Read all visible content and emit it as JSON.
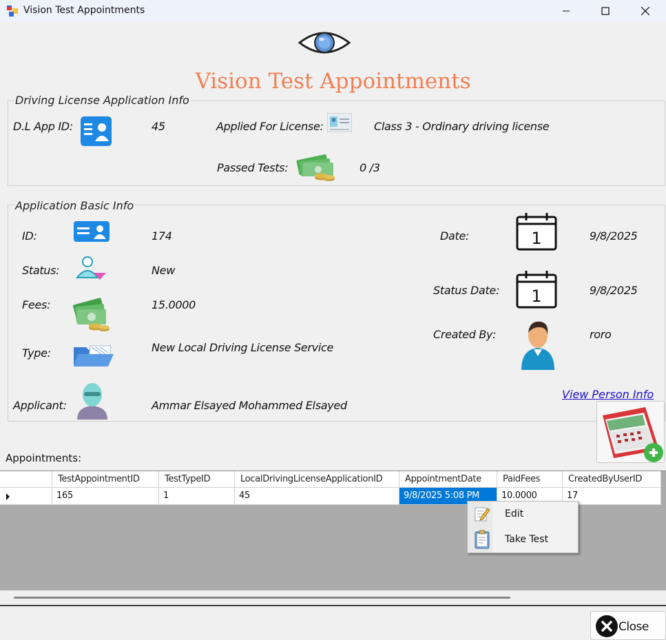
{
  "window": {
    "title": "Vision Test Appointments",
    "controls": {
      "minimize": "minimize-icon",
      "maximize": "maximize-icon",
      "close": "close-icon"
    }
  },
  "header": {
    "title": "Vision Test Appointments",
    "icon": "eye-icon",
    "title_color": "#f27f53"
  },
  "license_info": {
    "legend": "Driving License Application Info",
    "app_id_label": "D.L App ID:",
    "app_id_value": "45",
    "applied_for_label": "Applied For License:",
    "applied_for_value": "Class 3 - Ordinary driving license",
    "passed_tests_label": "Passed Tests:",
    "passed_tests_value": "0  /3"
  },
  "basic_info": {
    "legend": "Application Basic Info",
    "id_label": "ID:",
    "id_value": "174",
    "status_label": "Status:",
    "status_value": "New",
    "fees_label": "Fees:",
    "fees_value": "15.0000",
    "type_label": "Type:",
    "type_value": "New Local Driving License Service",
    "applicant_label": "Applicant:",
    "applicant_value": "Ammar Elsayed Mohammed Elsayed",
    "date_label": "Date:",
    "date_value": "9/8/2025",
    "status_date_label": "Status Date:",
    "status_date_value": "9/8/2025",
    "created_by_label": "Created By:",
    "created_by_value": "roro",
    "view_person_link": "View Person Info"
  },
  "appointments": {
    "label": "Appointments:",
    "columns": [
      "TestAppointmentID",
      "TestTypeID",
      "LocalDrivingLicenseApplicationID",
      "AppointmentDate",
      "PaidFees",
      "CreatedByUserID"
    ],
    "rows": [
      [
        "165",
        "1",
        "45",
        "9/8/2025 5:08 PM",
        "10.0000",
        "17"
      ]
    ],
    "selected_color": "#0078d7"
  },
  "context_menu": {
    "items": [
      {
        "label": "Edit",
        "icon": "edit-icon"
      },
      {
        "label": "Take Test",
        "icon": "clipboard-icon"
      }
    ]
  },
  "footer": {
    "close_label": "Close"
  }
}
